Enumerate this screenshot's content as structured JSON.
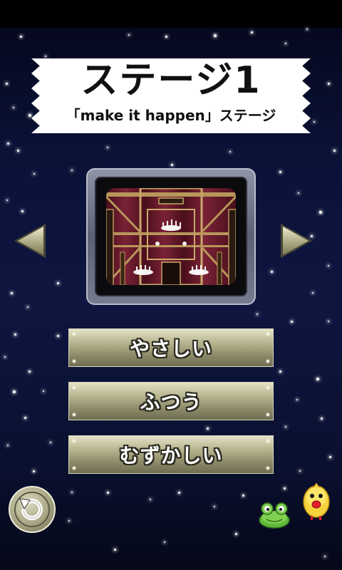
{
  "stage": {
    "title": "ステージ1",
    "subtitle": "「make it happen」ステージ"
  },
  "difficulty": {
    "easy_label": "やさしい",
    "normal_label": "ふつう",
    "hard_label": "むずかしい"
  },
  "icons": {
    "prev": "left-triangle-arrow-icon",
    "next": "right-triangle-arrow-icon",
    "back": "circular-back-arrow-icon",
    "frog": "frog-character-icon",
    "chick": "chick-character-icon"
  },
  "colors": {
    "background": "#0b1238",
    "button_metal": "#b9b692",
    "banner": "#ffffff",
    "stage_curtain": "#6a1a2c"
  }
}
